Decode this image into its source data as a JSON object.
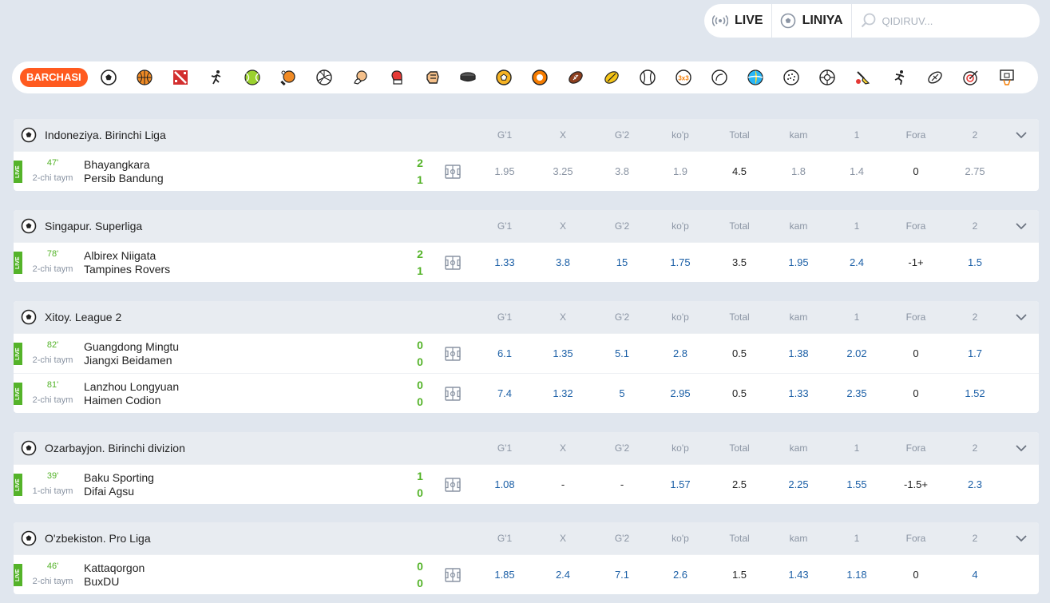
{
  "topbar": {
    "live_label": "LIVE",
    "liniya_label": "LINIYA",
    "search_placeholder": "QIDIRUV..."
  },
  "sports_bar": {
    "all_label": "BARCHASI",
    "icons": [
      "football-icon",
      "basketball-icon",
      "dota-icon",
      "hockey-player-icon",
      "tennis-icon",
      "table-tennis-icon",
      "volleyball-icon",
      "handball-icon",
      "boxing-icon",
      "mma-icon",
      "ice-hockey-icon",
      "futsal-icon",
      "basketball-3x3-icon",
      "american-football-icon",
      "rugby-icon",
      "baseball-icon",
      "esports-3x3-icon",
      "snooker-icon",
      "beach-volleyball-icon",
      "golf-icon",
      "water-polo-icon",
      "badminton-icon",
      "athletics-icon",
      "aussie-rules-icon",
      "darts-icon",
      "board-basketball-icon"
    ]
  },
  "columns": [
    "G'1",
    "X",
    "G'2",
    "ko'p",
    "Total",
    "kam",
    "1",
    "Fora",
    "2"
  ],
  "leagues": [
    {
      "title": "Indoneziya. Birinchi Liga",
      "matches": [
        {
          "live": "LIVE",
          "minute": "47'",
          "half": "2-chi taym",
          "team1": "Bhayangkara",
          "team2": "Persib Bandung",
          "score1": "2",
          "score2": "1",
          "odds": [
            "1.95",
            "3.25",
            "3.8",
            "1.9",
            "4.5",
            "1.8",
            "1.4",
            "0",
            "2.75"
          ],
          "active": false
        }
      ]
    },
    {
      "title": "Singapur. Superliga",
      "matches": [
        {
          "live": "LIVE",
          "minute": "78'",
          "half": "2-chi taym",
          "team1": "Albirex Niigata",
          "team2": "Tampines Rovers",
          "score1": "2",
          "score2": "1",
          "odds": [
            "1.33",
            "3.8",
            "15",
            "1.75",
            "3.5",
            "1.95",
            "2.4",
            "-1+",
            "1.5"
          ],
          "active": true
        }
      ]
    },
    {
      "title": "Xitoy. League 2",
      "matches": [
        {
          "live": "LIVE",
          "minute": "82'",
          "half": "2-chi taym",
          "team1": "Guangdong Mingtu",
          "team2": "Jiangxi Beidamen",
          "score1": "0",
          "score2": "0",
          "odds": [
            "6.1",
            "1.35",
            "5.1",
            "2.8",
            "0.5",
            "1.38",
            "2.02",
            "0",
            "1.7"
          ],
          "active": true
        },
        {
          "live": "LIVE",
          "minute": "81'",
          "half": "2-chi taym",
          "team1": "Lanzhou Longyuan",
          "team2": "Haimen Codion",
          "score1": "0",
          "score2": "0",
          "odds": [
            "7.4",
            "1.32",
            "5",
            "2.95",
            "0.5",
            "1.33",
            "2.35",
            "0",
            "1.52"
          ],
          "active": true
        }
      ]
    },
    {
      "title": "Ozarbayjon. Birinchi divizion",
      "matches": [
        {
          "live": "LIVE",
          "minute": "39'",
          "half": "1-chi taym",
          "team1": "Baku Sporting",
          "team2": "Difai Agsu",
          "score1": "1",
          "score2": "0",
          "odds": [
            "1.08",
            "-",
            "-",
            "1.57",
            "2.5",
            "2.25",
            "1.55",
            "-1.5+",
            "2.3"
          ],
          "active": true
        }
      ]
    },
    {
      "title": "O'zbekiston. Pro Liga",
      "matches": [
        {
          "live": "LIVE",
          "minute": "46'",
          "half": "2-chi taym",
          "team1": "Kattaqorgon",
          "team2": "BuxDU",
          "score1": "0",
          "score2": "0",
          "odds": [
            "1.85",
            "2.4",
            "7.1",
            "2.6",
            "1.5",
            "1.43",
            "1.18",
            "0",
            "4"
          ],
          "active": true
        }
      ]
    }
  ]
}
